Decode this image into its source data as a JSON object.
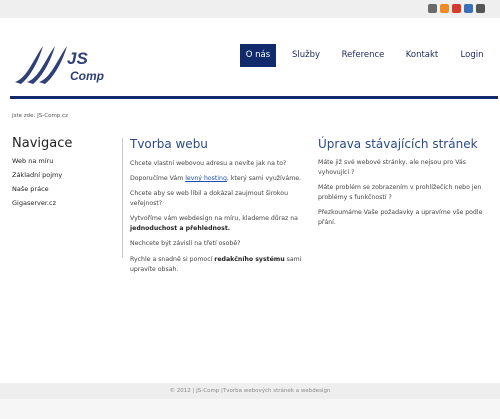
{
  "social": {
    "icons": [
      {
        "name": "share-icon",
        "color": "#6a6a6a"
      },
      {
        "name": "rss-icon",
        "color": "#f08a24"
      },
      {
        "name": "youtube-icon",
        "color": "#d63a2a"
      },
      {
        "name": "flickr-icon",
        "color": "#3b6fb8"
      },
      {
        "name": "mail-icon",
        "color": "#555555"
      }
    ]
  },
  "logo": {
    "line1": "JS",
    "line2": "Comp"
  },
  "nav": {
    "items": [
      {
        "label": "O nás",
        "active": true
      },
      {
        "label": "Služby"
      },
      {
        "label": "Reference"
      },
      {
        "label": "Kontakt"
      },
      {
        "label": "Login"
      }
    ]
  },
  "breadcrumb": "Jste zde: JS-Comp.cz",
  "sidebar": {
    "title": "Navigace",
    "links": [
      "Web na míru",
      "Základní pojmy",
      "Naše práce",
      "Gigaserver.cz"
    ]
  },
  "web": {
    "title": "Tvorba webu",
    "p1": "Chcete vlastní webovou adresu a nevíte jak na to?",
    "p2_before": "Doporučíme Vám ",
    "p2_link": "levný hosting",
    "p2_after": ", který sami využíváme.",
    "p3": "Chcete aby se web líbil a dokázal zaujmout širokou veřejnost?",
    "p4_before": "Vytvoříme vám webdesign na míru, klademe důraz na ",
    "p4_bold": "jednoduchost a přehlednost.",
    "p5": "Nechcete být závislí na třetí osobě?",
    "p6_before": "Rychle a snadně si pomocí ",
    "p6_bold": "redakčního systému",
    "p6_after": " sami upravíte obsah."
  },
  "edit": {
    "title": "Úprava stávajících stránek",
    "p1": "Máte již své webové stránky, ale nejsou pro Vás vyhovující ?",
    "p2": "Máte problém se zobrazením v prohlížečích nebo jen problémy s funkčností ?",
    "p3": "Přezkoumáme Vaše požadavky a upravíme vše podle přání."
  },
  "footer": "© 2012 | JS-Comp |Tvorba webových stránek a webdesign",
  "colors": {
    "brand": "#102a6b",
    "heading": "#2a4a8c"
  }
}
